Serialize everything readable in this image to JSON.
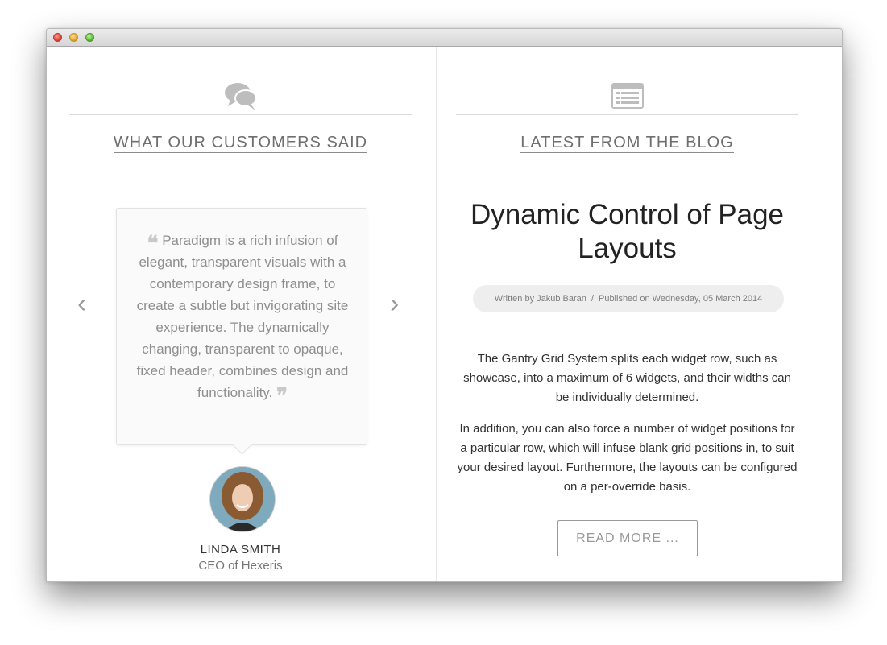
{
  "window": {
    "traffic_lights": [
      "close",
      "minimize",
      "zoom"
    ]
  },
  "testimonials": {
    "title": "WHAT OUR CUSTOMERS SAID",
    "icon": "speech-bubbles-icon",
    "quote": "Paradigm is a rich infusion of elegant, transparent visuals with a contemporary design frame, to create a subtle but invigorating site experience. The dynamically changing, transparent to opaque, fixed header, combines design and functionality.",
    "quote_open": "❝",
    "quote_close": "❞",
    "prev_arrow": "‹",
    "next_arrow": "›",
    "person": {
      "name": "LINDA SMITH",
      "role": "CEO of Hexeris"
    }
  },
  "blog": {
    "title": "LATEST FROM THE BLOG",
    "icon": "list-icon",
    "post_title": "Dynamic Control of Page Layouts",
    "meta": {
      "author": "Written by Jakub Baran",
      "separator": "/",
      "published": "Published on Wednesday, 05 March 2014"
    },
    "paragraph_1": "The Gantry Grid System splits each widget row, such as showcase, into a maximum of 6 widgets, and their widths can be individually determined.",
    "paragraph_2": "In addition, you can also force a number of widget positions for a particular row, which will infuse blank grid positions in, to suit your desired layout. Furthermore, the layouts can be configured on a per-override basis.",
    "read_more": "READ MORE ..."
  }
}
